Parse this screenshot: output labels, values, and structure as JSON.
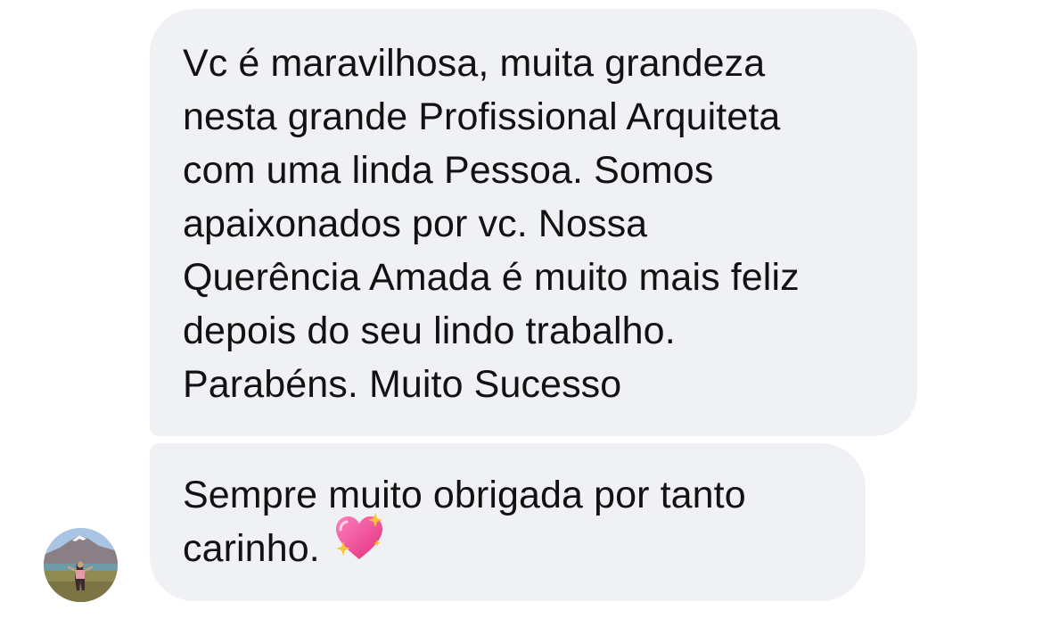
{
  "messages": [
    {
      "sender": "other",
      "lines": [
        "Vc é maravilhosa, muita grandeza",
        "nesta grande Profissional Arquiteta",
        "com uma linda Pessoa. Somos",
        "apaixonados por vc. Nossa",
        "Querência Amada é muito mais feliz",
        "depois do seu lindo trabalho.",
        "Parabéns. Muito Sucesso"
      ]
    },
    {
      "sender": "other",
      "lines": [
        "Sempre muito obrigada por tanto",
        "carinho."
      ],
      "emoji": "sparkling-heart-icon"
    }
  ],
  "avatar": {
    "icon": "user-avatar-photo"
  },
  "colors": {
    "bubble_bg": "#f0f1f4",
    "text": "#121212",
    "heart_pink": "#f0509a",
    "sparkle_yellow": "#fbc531"
  }
}
